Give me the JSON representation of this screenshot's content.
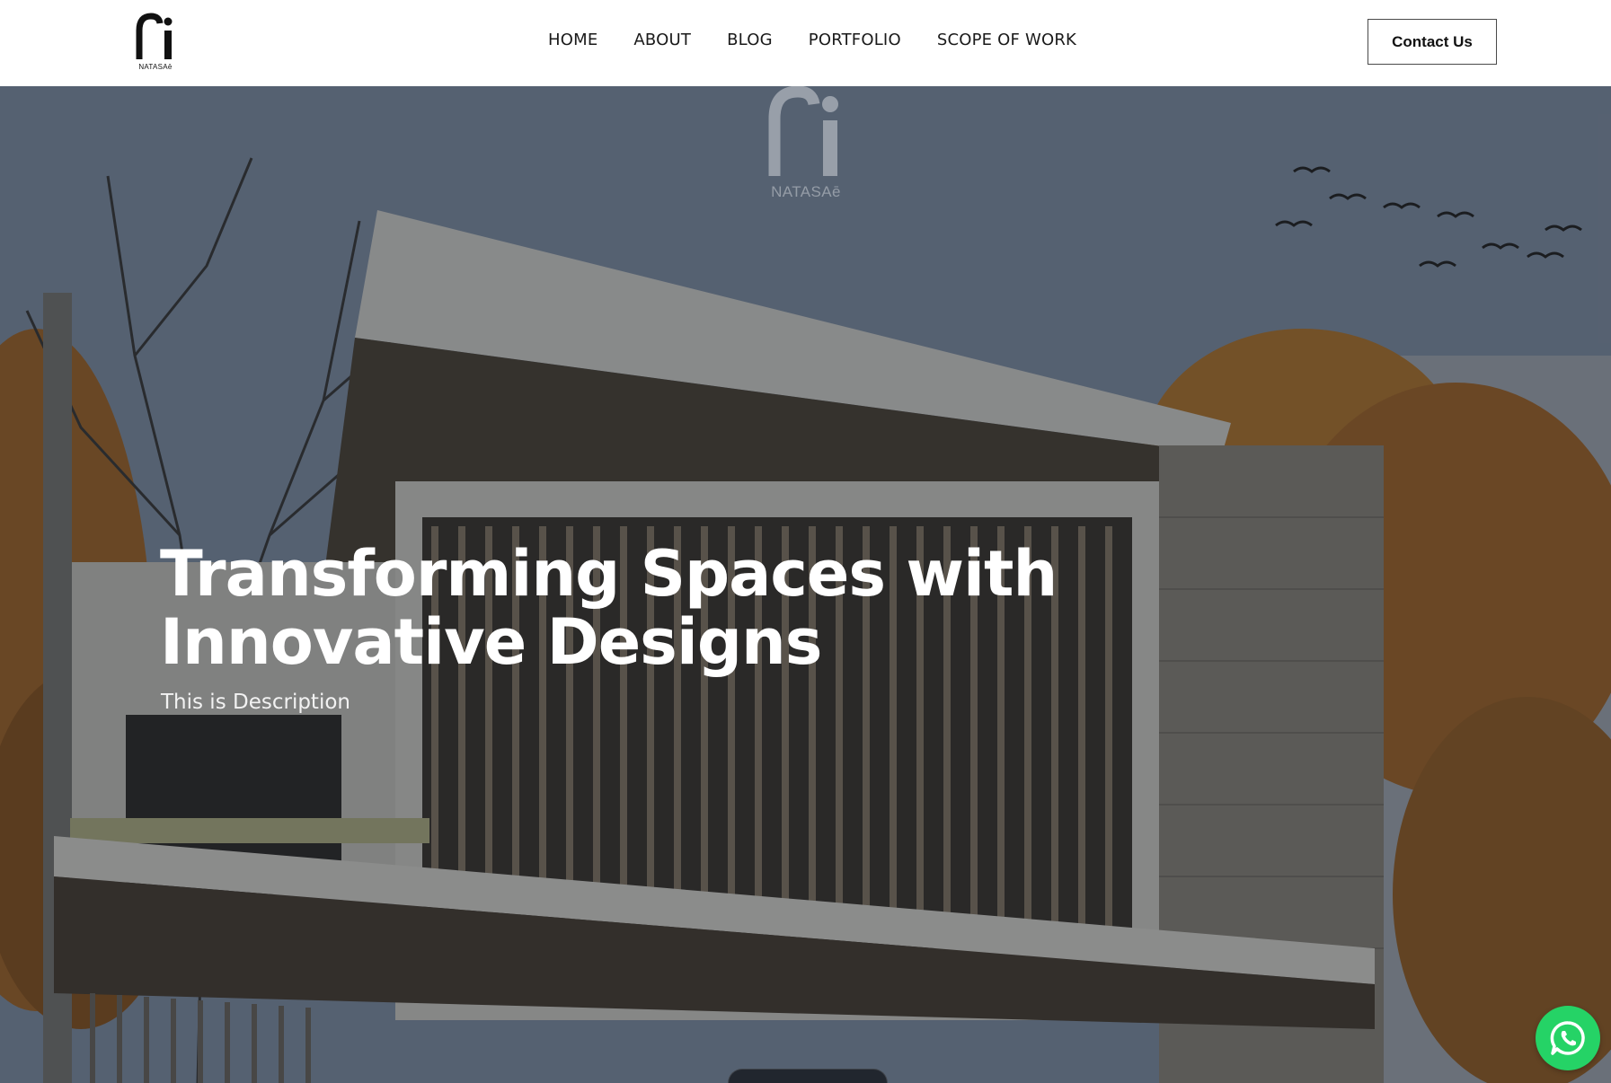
{
  "brand": {
    "logo_text": "NATASAē",
    "watermark_text": "NATASAē"
  },
  "nav": {
    "items": [
      {
        "label": "HOME"
      },
      {
        "label": "ABOUT"
      },
      {
        "label": "BLOG"
      },
      {
        "label": "PORTFOLIO"
      },
      {
        "label": "SCOPE OF WORK"
      }
    ],
    "contact_label": "Contact Us"
  },
  "hero": {
    "title": "Transforming Spaces with Innovative Designs",
    "description": "This is Description"
  },
  "floating": {
    "whatsapp_icon": "whatsapp-icon",
    "whatsapp_color": "#25d366"
  },
  "colors": {
    "header_bg": "#ffffff",
    "text_dark": "#1a1a1a",
    "hero_text": "#ffffff"
  }
}
